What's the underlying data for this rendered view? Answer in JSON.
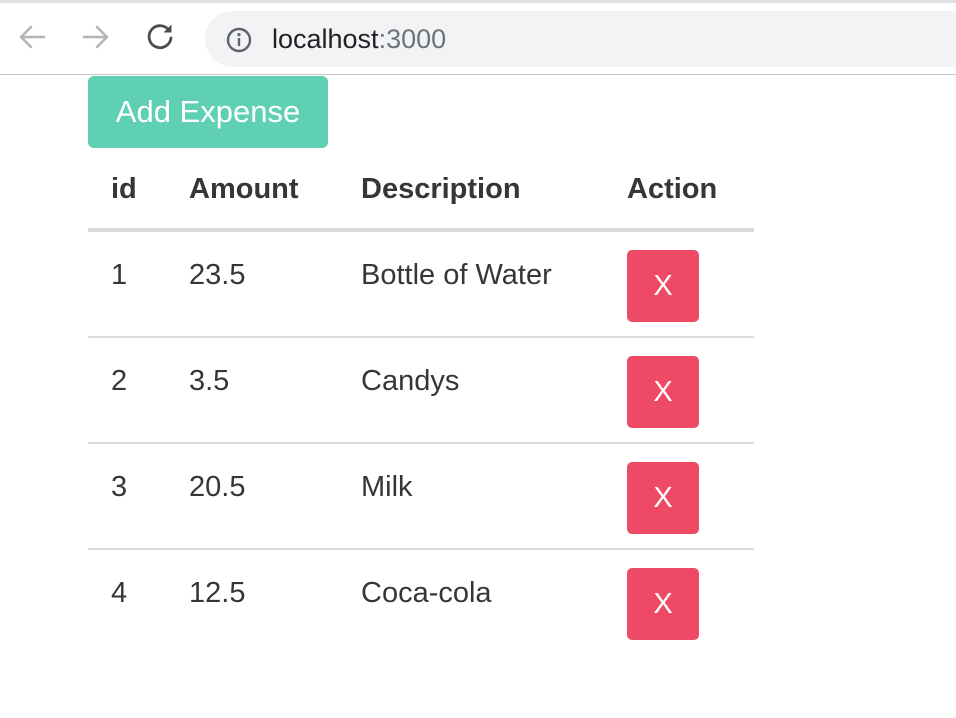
{
  "browser": {
    "url_host": "localhost",
    "url_port": ":3000"
  },
  "toolbar": {
    "add_label": "Add Expense"
  },
  "table": {
    "headers": {
      "id": "id",
      "amount": "Amount",
      "description": "Description",
      "action": "Action"
    },
    "rows": [
      {
        "id": "1",
        "amount": "23.5",
        "description": "Bottle of Water",
        "delete_label": "X"
      },
      {
        "id": "2",
        "amount": "3.5",
        "description": "Candys",
        "delete_label": "X"
      },
      {
        "id": "3",
        "amount": "20.5",
        "description": "Milk",
        "delete_label": "X"
      },
      {
        "id": "4",
        "amount": "12.5",
        "description": "Coca-cola",
        "delete_label": "X"
      }
    ]
  },
  "colors": {
    "add_button": "#5fd0b3",
    "delete_button": "#ee4a66"
  },
  "icons": {
    "back": "arrow-left-icon",
    "forward": "arrow-right-icon",
    "reload": "reload-icon",
    "site_info": "info-icon"
  }
}
